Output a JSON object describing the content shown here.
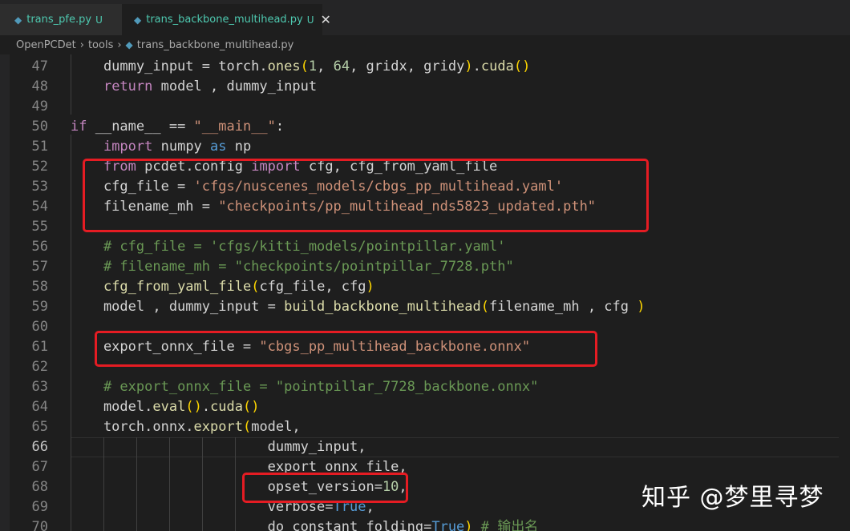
{
  "tabs": [
    {
      "name": "trans_pfe.py",
      "status": "U"
    },
    {
      "name": "trans_backbone_multihead.py",
      "status": "U"
    }
  ],
  "breadcrumb": [
    "OpenPCDet",
    "tools",
    "trans_backbone_multihead.py"
  ],
  "lines": [
    {
      "n": "47",
      "code": "    dummy_input = torch.ones(1, 64, gridx, gridy).cuda()"
    },
    {
      "n": "48",
      "code": "    return model , dummy_input"
    },
    {
      "n": "49",
      "code": ""
    },
    {
      "n": "50",
      "code": "if __name__ == \"__main__\":"
    },
    {
      "n": "51",
      "code": "    import numpy as np"
    },
    {
      "n": "52",
      "code": "    from pcdet.config import cfg, cfg_from_yaml_file"
    },
    {
      "n": "53",
      "code": "    cfg_file = 'cfgs/nuscenes_models/cbgs_pp_multihead.yaml'"
    },
    {
      "n": "54",
      "code": "    filename_mh = \"checkpoints/pp_multihead_nds5823_updated.pth\""
    },
    {
      "n": "55",
      "code": ""
    },
    {
      "n": "56",
      "code": "    # cfg_file = 'cfgs/kitti_models/pointpillar.yaml'"
    },
    {
      "n": "57",
      "code": "    # filename_mh = \"checkpoints/pointpillar_7728.pth\""
    },
    {
      "n": "58",
      "code": "    cfg_from_yaml_file(cfg_file, cfg)"
    },
    {
      "n": "59",
      "code": "    model , dummy_input = build_backbone_multihead(filename_mh , cfg )"
    },
    {
      "n": "60",
      "code": ""
    },
    {
      "n": "61",
      "code": "    export_onnx_file = \"cbgs_pp_multihead_backbone.onnx\""
    },
    {
      "n": "62",
      "code": ""
    },
    {
      "n": "63",
      "code": "    # export_onnx_file = \"pointpillar_7728_backbone.onnx\""
    },
    {
      "n": "64",
      "code": "    model.eval().cuda()"
    },
    {
      "n": "65",
      "code": "    torch.onnx.export(model,"
    },
    {
      "n": "66",
      "code": "                        dummy_input,"
    },
    {
      "n": "67",
      "code": "                        export_onnx_file,"
    },
    {
      "n": "68",
      "code": "                        opset_version=10,"
    },
    {
      "n": "69",
      "code": "                        verbose=True,"
    },
    {
      "n": "70",
      "code": "                        do_constant_folding=True) # 输出名"
    }
  ],
  "watermark": "知乎 @梦里寻梦",
  "colors": {
    "highlight_box": "#e51c23",
    "keyword": "#569cd6",
    "string": "#ce9178",
    "comment": "#6a9955",
    "number": "#b5cea8"
  }
}
